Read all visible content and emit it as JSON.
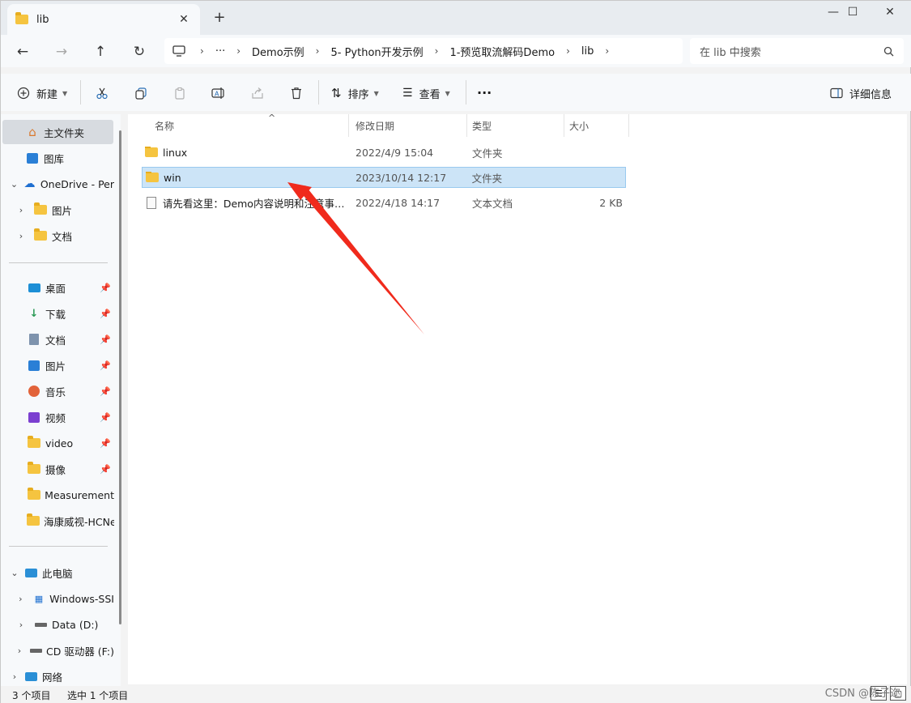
{
  "tab": {
    "title": "lib",
    "close": "✕",
    "new_tab": "+"
  },
  "window_controls": {
    "minimize": "—",
    "maximize": "☐",
    "close": "✕"
  },
  "nav": {
    "back": "←",
    "forward": "→",
    "up": "↑",
    "refresh": "↻",
    "breadcrumb": [
      "Demo示例",
      "5- Python开发示例",
      "1-预览取流解码Demo",
      "lib"
    ],
    "more": "···",
    "search_placeholder": "在 lib 中搜索"
  },
  "toolbar": {
    "new": "新建",
    "sort": "排序",
    "view": "查看",
    "more": "···",
    "details": "详细信息"
  },
  "sidebar": {
    "home": "主文件夹",
    "gallery": "图库",
    "onedrive": "OneDrive - Per",
    "od_pictures": "图片",
    "od_documents": "文档",
    "quick": [
      {
        "label": "桌面",
        "icon": "desktop-icon"
      },
      {
        "label": "下载",
        "icon": "download-icon"
      },
      {
        "label": "文档",
        "icon": "documents-icon"
      },
      {
        "label": "图片",
        "icon": "pictures-icon"
      },
      {
        "label": "音乐",
        "icon": "music-icon"
      },
      {
        "label": "视频",
        "icon": "videos-icon"
      },
      {
        "label": "video",
        "icon": "folder-icon"
      },
      {
        "label": "摄像",
        "icon": "folder-icon"
      },
      {
        "label": "Measurement",
        "icon": "folder-icon"
      },
      {
        "label": "海康威视-HCNe",
        "icon": "folder-icon"
      }
    ],
    "this_pc": "此电脑",
    "drives": [
      "Windows-SSI",
      "Data (D:)",
      "CD 驱动器 (F:)"
    ],
    "network": "网络"
  },
  "columns": {
    "name": "名称",
    "date": "修改日期",
    "type": "类型",
    "size": "大小"
  },
  "files": [
    {
      "name": "linux",
      "date": "2022/4/9 15:04",
      "type": "文件夹",
      "size": "",
      "kind": "folder"
    },
    {
      "name": "win",
      "date": "2023/10/14 12:17",
      "type": "文件夹",
      "size": "",
      "kind": "folder",
      "selected": true
    },
    {
      "name": "请先看这里：Demo内容说明和注意事项...",
      "date": "2022/4/18 14:17",
      "type": "文本文档",
      "size": "2 KB",
      "kind": "text"
    }
  ],
  "status": {
    "count": "3 个项目",
    "selected": "选中 1 个项目"
  },
  "watermark": "CSDN @陈子迩",
  "colors": {
    "selection": "#cce4f7",
    "selection_border": "#99c9ef",
    "folder": "#f5c440",
    "annotation_arrow": "#f02a1c"
  }
}
